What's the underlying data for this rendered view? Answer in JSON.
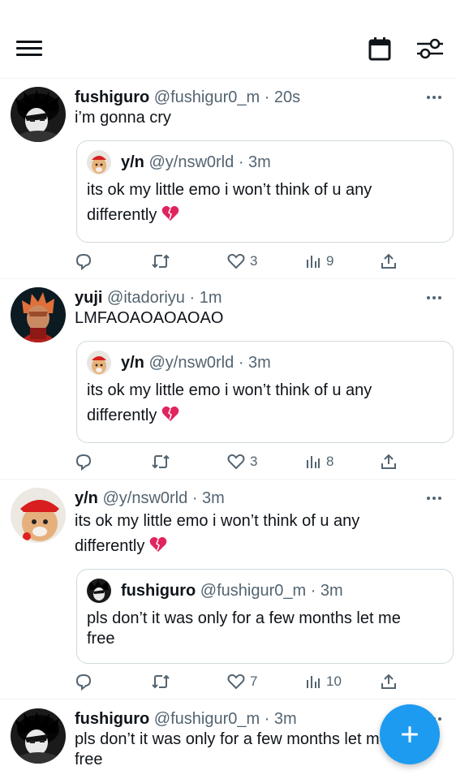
{
  "colors": {
    "accent": "#1d9bf0",
    "text": "#0f1419",
    "muted": "#536471",
    "border": "#cfd9de",
    "broken_heart": "#e0245e"
  },
  "icons": {
    "menu": "hamburger-icon",
    "calendar": "calendar-icon",
    "filter": "sliders-icon",
    "compose": "plus-icon"
  },
  "posts": [
    {
      "name": "fushiguro",
      "handle": "@fushigur0_m",
      "time": "· 20s",
      "text": "i’m gonna cry",
      "quote": {
        "name": "y/n",
        "handle": "@y/nsw0rld",
        "time": "· 3m",
        "text": "its ok my little emo i won’t think of u any differently"
      },
      "likes": "3",
      "views": "9"
    },
    {
      "name": "yuji",
      "handle": "@itadoriyu",
      "time": "· 1m",
      "text": "LMFAOAOAOAOAO",
      "quote": {
        "name": "y/n",
        "handle": "@y/nsw0rld",
        "time": "· 3m",
        "text": "its ok my little emo i won’t think of u any differently"
      },
      "likes": "3",
      "views": "8"
    },
    {
      "name": "y/n",
      "handle": "@y/nsw0rld",
      "time": "· 3m",
      "text": "its ok my little emo i won’t think of u any differently",
      "quote": {
        "name": "fushiguro",
        "handle": "@fushigur0_m",
        "time": "· 3m",
        "text": "pls don’t it was only for a few months let me free"
      },
      "likes": "7",
      "views": "10"
    },
    {
      "name": "fushiguro",
      "handle": "@fushigur0_m",
      "time": "· 3m",
      "text": "pls don’t it was only for a few months let me free"
    }
  ]
}
